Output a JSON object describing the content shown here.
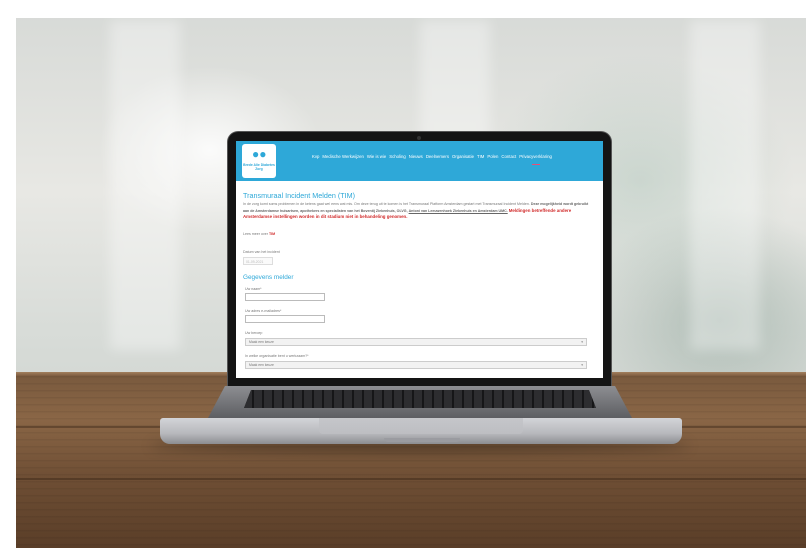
{
  "site": {
    "logo_text": "Brede Alie Diabetes Zorg",
    "nav": [
      "Kvp",
      "Medische Werkwijzen",
      "Wie is wie",
      "Scholing",
      "Nieuws",
      "Deelnemers",
      "Organisatie",
      "TIM",
      "Polen",
      "Contact",
      "Privacyverklaring"
    ]
  },
  "page": {
    "title": "Transmuraal Incident Melden (TIM)",
    "intro_plain": "In de zorg komt soms problemen in de ketens gaat wel eens wat mis. Om deze terug uit te komen is het Transmuraal Platform Amsterdam gestart met Transmuraal Incident Melden.",
    "intro_bold": "Deze mogelijkheid wordt gebruikt aan de Amsterdamse huisartsen, apothekers en specialisten van het Boventij Ziekenhuis, OLVG,",
    "intro_links": "Antoni van Leeuwenhoek Ziekenhuis en Amsterdam UMC.",
    "intro_red": "Meldingen betreffende andere Amsterdamse instellingen worden in dit stadium niet in behandeling genomen.",
    "lees_meer_prefix": "Lees meer over",
    "lees_meer_link": "TIM",
    "datum_label": "Datum van het incident",
    "datum_placeholder": "01-09-2021",
    "section_title": "Gegevens melder",
    "field_naam": "Uw naam*",
    "field_email": "Uw adres e-mailadres*",
    "field_beroep": "Uw beroep",
    "select_placeholder": "Maak een keuze",
    "field_organisatie": "In welke organisatie bent u werkzaam?*",
    "select_placeholder_2": "Maak een keuze"
  }
}
